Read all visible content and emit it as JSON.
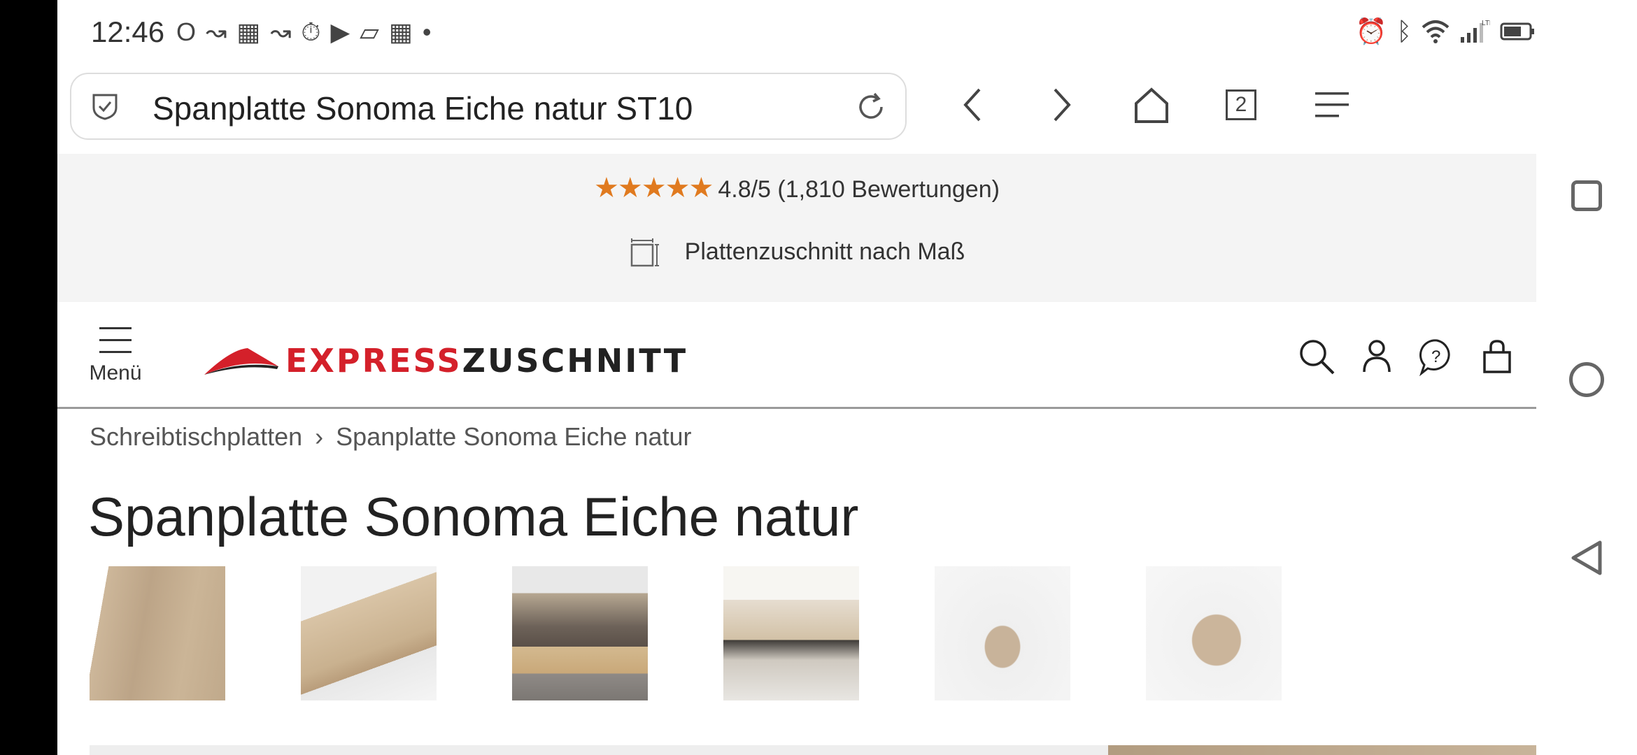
{
  "statusbar": {
    "time": "12:46"
  },
  "browser": {
    "url_text": "Spanplatte Sonoma Eiche natur ST10",
    "tab_count": "2"
  },
  "promo": {
    "stars": "★★★★★",
    "rating_text": "4.8/5 (1,810 Bewertungen)",
    "cut_text": "Plattenzuschnitt nach Maß",
    "star_color": "#e07a1f"
  },
  "header": {
    "menu_label": "Menü",
    "logo_part1": "EXPRESS",
    "logo_part2": "ZUSCHNITT",
    "brand_color": "#d4202a"
  },
  "breadcrumb": {
    "item1": "Schreibtischplatten",
    "separator": "›",
    "item2": "Spanplatte Sonoma Eiche natur"
  },
  "product": {
    "title": "Spanplatte Sonoma Eiche natur",
    "thumbnails": [
      "oak-board-closeup",
      "board-edge-on-marble",
      "kitchen-island",
      "dining-table",
      "coffee-table",
      "side-table"
    ]
  }
}
